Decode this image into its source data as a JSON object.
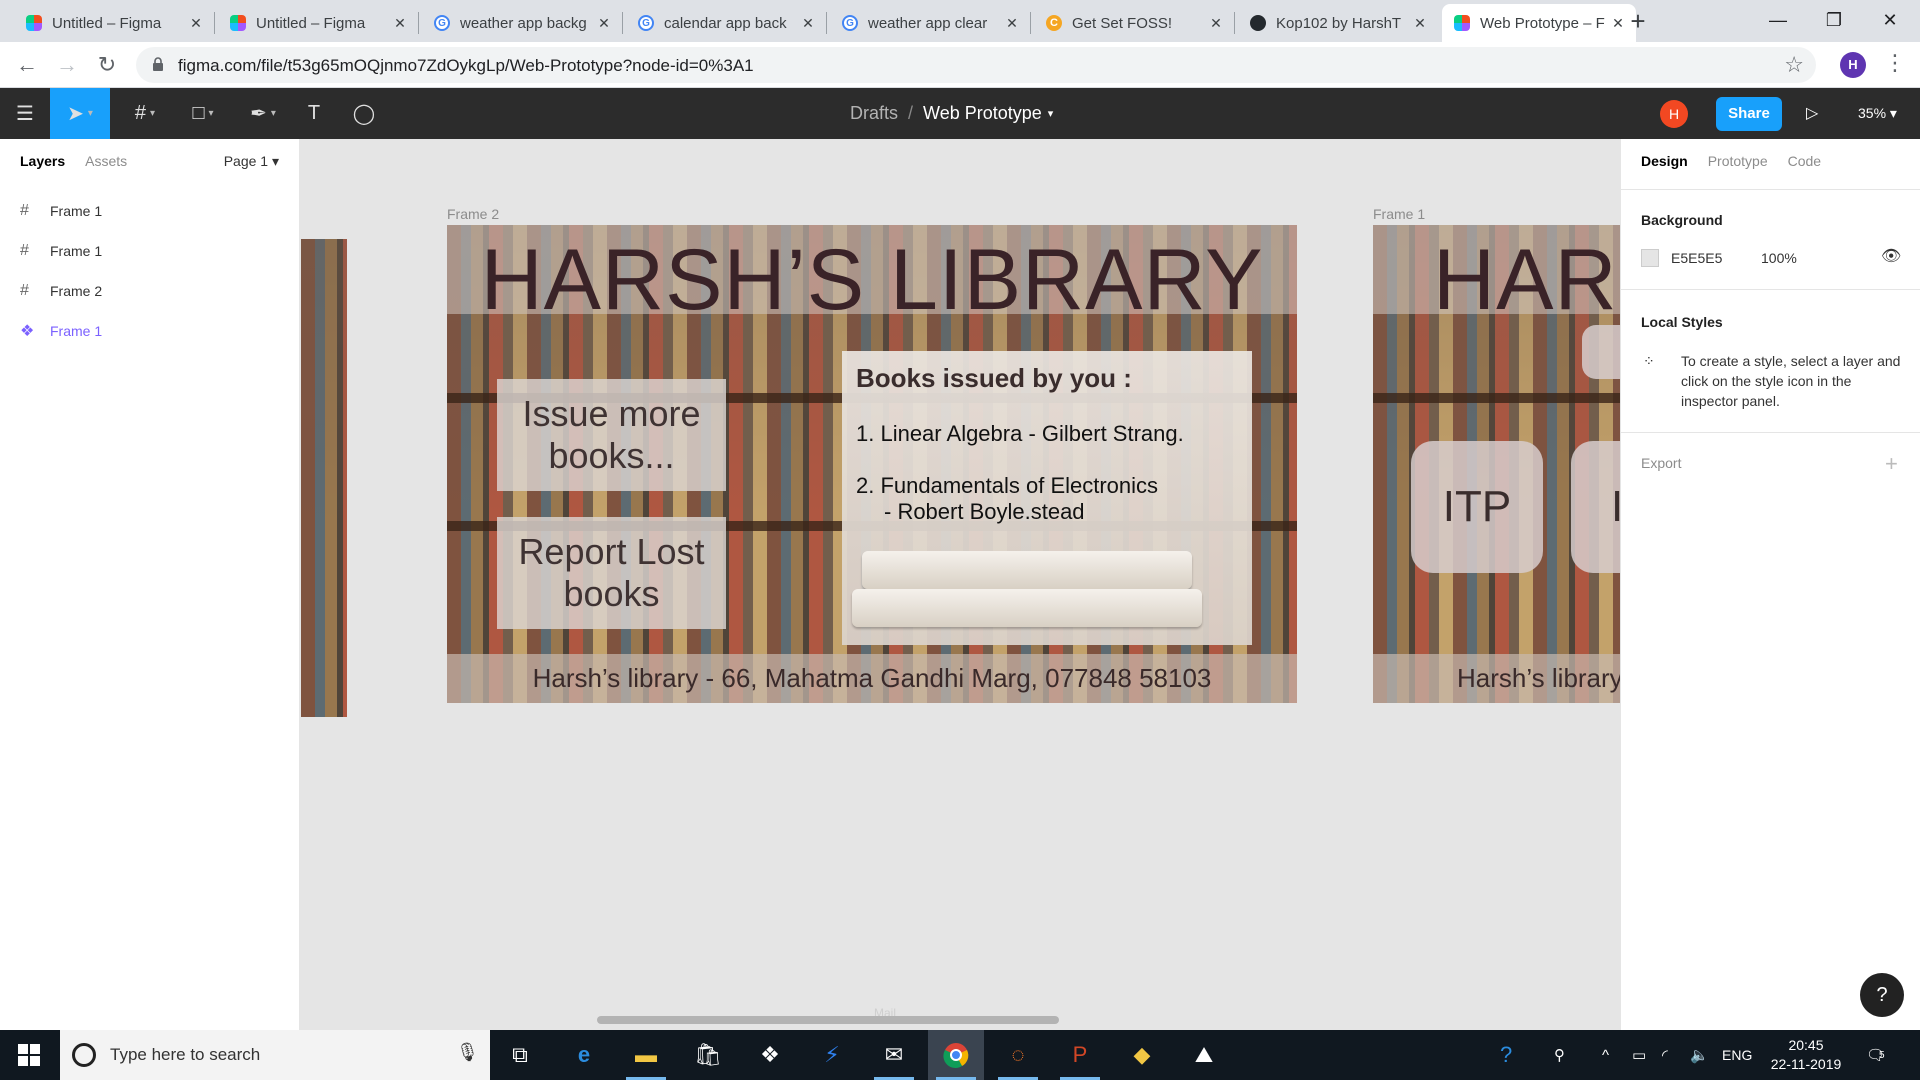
{
  "browser": {
    "tabs": [
      {
        "title": "Untitled – Figma",
        "icon": "figma-icon"
      },
      {
        "title": "Untitled – Figma",
        "icon": "figma-icon"
      },
      {
        "title": "weather app backg",
        "icon": "google-icon"
      },
      {
        "title": "calendar app back",
        "icon": "google-icon"
      },
      {
        "title": "weather app clear",
        "icon": "google-icon"
      },
      {
        "title": "Get Set FOSS!",
        "icon": "foss-icon"
      },
      {
        "title": "Kop102 by HarshT",
        "icon": "github-icon"
      },
      {
        "title": "Web Prototype – F",
        "icon": "figma-icon",
        "active": true
      }
    ],
    "url": "figma.com/file/t53g65mOQjnmo7ZdOykgLp/Web-Prototype?node-id=0%3A1",
    "profile_initial": "H"
  },
  "figma": {
    "breadcrumb_drafts": "Drafts",
    "breadcrumb_sep": "/",
    "file_name": "Web Prototype",
    "user_initial": "H",
    "share_label": "Share",
    "zoom": "35%",
    "left_panel": {
      "tab_layers": "Layers",
      "tab_assets": "Assets",
      "page": "Page 1",
      "layers": [
        {
          "name": "Frame 1",
          "icon": "frame-icon"
        },
        {
          "name": "Frame 1",
          "icon": "frame-icon"
        },
        {
          "name": "Frame 2",
          "icon": "frame-icon"
        },
        {
          "name": "Frame 1",
          "icon": "component-icon",
          "selected": true
        }
      ]
    },
    "right_panel": {
      "tab_design": "Design",
      "tab_prototype": "Prototype",
      "tab_code": "Code",
      "background_label": "Background",
      "background_hex": "E5E5E5",
      "background_opacity": "100%",
      "local_styles_label": "Local Styles",
      "local_styles_hint": "To create a style, select a layer and click on the style icon in the inspector panel.",
      "export_label": "Export"
    },
    "canvas": {
      "frame2_label": "Frame 2",
      "frame1_label": "Frame 1",
      "frame2": {
        "title": "HARSH’S LIBRARY",
        "btn_issue": "Issue more books...",
        "btn_report": "Report Lost books",
        "books_heading": "Books issued by you :",
        "book1": "1. Linear Algebra - Gilbert Strang.",
        "book2_line1": "2. Fundamentals of Electronics",
        "book2_line2": "- Robert Boyle.stead",
        "footer": "Harsh’s library - 66, Mahatma Gandhi Marg, 077848 58103"
      },
      "frame1": {
        "title_partial": "HARS",
        "pill_itp": "ITP",
        "pill_partial": "I",
        "footer_partial": "Harsh’s library"
      },
      "scrollbar_ghost_label": "Mail"
    }
  },
  "taskbar": {
    "search_placeholder": "Type here to search",
    "language": "ENG",
    "time": "20:45",
    "date": "22-11-2019",
    "notification_count": "5"
  }
}
